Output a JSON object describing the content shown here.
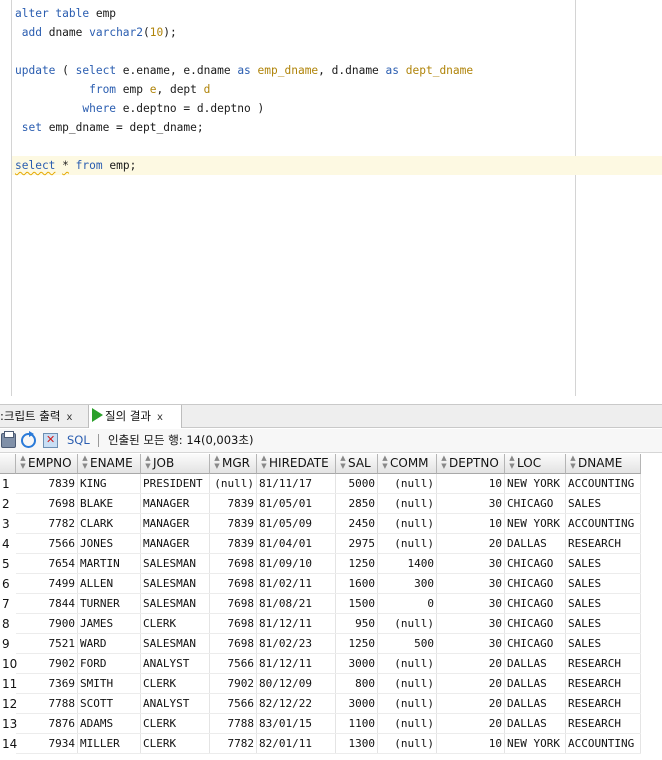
{
  "editor": {
    "lines": [
      "alter table emp",
      " add dname varchar2(10);",
      "",
      "update ( select e.ename, e.dname as emp_dname, d.dname as dept_dname",
      "           from emp e, dept d",
      "          where e.deptno = d.deptno )",
      " set emp_dname = dept_dname;",
      "",
      "select * from emp;"
    ]
  },
  "tabs": [
    {
      "label": ":크립트 출력",
      "close": "x"
    },
    {
      "label": "질의 결과",
      "close": "x"
    }
  ],
  "toolbar": {
    "sql_label": "SQL",
    "status": "인출된 모든 행: 14(0,003초)"
  },
  "grid": {
    "columns": [
      "EMPNO",
      "ENAME",
      "JOB",
      "MGR",
      "HIREDATE",
      "SAL",
      "COMM",
      "DEPTNO",
      "LOC",
      "DNAME"
    ],
    "rows": [
      [
        "7839",
        "KING",
        "PRESIDENT",
        "(null)",
        "81/11/17",
        "5000",
        "(null)",
        "10",
        "NEW YORK",
        "ACCOUNTING"
      ],
      [
        "7698",
        "BLAKE",
        "MANAGER",
        "7839",
        "81/05/01",
        "2850",
        "(null)",
        "30",
        "CHICAGO",
        "SALES"
      ],
      [
        "7782",
        "CLARK",
        "MANAGER",
        "7839",
        "81/05/09",
        "2450",
        "(null)",
        "10",
        "NEW YORK",
        "ACCOUNTING"
      ],
      [
        "7566",
        "JONES",
        "MANAGER",
        "7839",
        "81/04/01",
        "2975",
        "(null)",
        "20",
        "DALLAS",
        "RESEARCH"
      ],
      [
        "7654",
        "MARTIN",
        "SALESMAN",
        "7698",
        "81/09/10",
        "1250",
        "1400",
        "30",
        "CHICAGO",
        "SALES"
      ],
      [
        "7499",
        "ALLEN",
        "SALESMAN",
        "7698",
        "81/02/11",
        "1600",
        "300",
        "30",
        "CHICAGO",
        "SALES"
      ],
      [
        "7844",
        "TURNER",
        "SALESMAN",
        "7698",
        "81/08/21",
        "1500",
        "0",
        "30",
        "CHICAGO",
        "SALES"
      ],
      [
        "7900",
        "JAMES",
        "CLERK",
        "7698",
        "81/12/11",
        "950",
        "(null)",
        "30",
        "CHICAGO",
        "SALES"
      ],
      [
        "7521",
        "WARD",
        "SALESMAN",
        "7698",
        "81/02/23",
        "1250",
        "500",
        "30",
        "CHICAGO",
        "SALES"
      ],
      [
        "7902",
        "FORD",
        "ANALYST",
        "7566",
        "81/12/11",
        "3000",
        "(null)",
        "20",
        "DALLAS",
        "RESEARCH"
      ],
      [
        "7369",
        "SMITH",
        "CLERK",
        "7902",
        "80/12/09",
        "800",
        "(null)",
        "20",
        "DALLAS",
        "RESEARCH"
      ],
      [
        "7788",
        "SCOTT",
        "ANALYST",
        "7566",
        "82/12/22",
        "3000",
        "(null)",
        "20",
        "DALLAS",
        "RESEARCH"
      ],
      [
        "7876",
        "ADAMS",
        "CLERK",
        "7788",
        "83/01/15",
        "1100",
        "(null)",
        "20",
        "DALLAS",
        "RESEARCH"
      ],
      [
        "7934",
        "MILLER",
        "CLERK",
        "7782",
        "82/01/11",
        "1300",
        "(null)",
        "10",
        "NEW YORK",
        "ACCOUNTING"
      ]
    ]
  }
}
